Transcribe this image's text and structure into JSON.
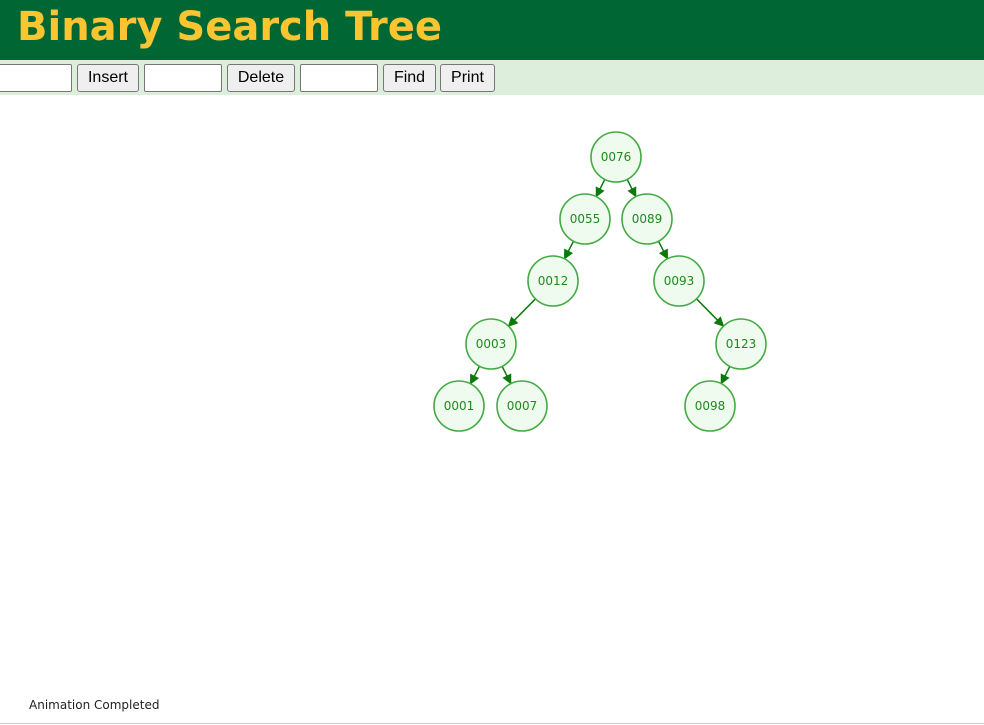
{
  "header": {
    "title": "Binary Search Tree"
  },
  "toolbar": {
    "insert_input_value": "",
    "insert_label": "Insert",
    "delete_input_value": "",
    "delete_label": "Delete",
    "find_input_value": "",
    "find_label": "Find",
    "print_label": "Print"
  },
  "tree": {
    "nodes": [
      {
        "id": "n76",
        "label": "0076"
      },
      {
        "id": "n55",
        "label": "0055"
      },
      {
        "id": "n89",
        "label": "0089"
      },
      {
        "id": "n12",
        "label": "0012"
      },
      {
        "id": "n93",
        "label": "0093"
      },
      {
        "id": "n3",
        "label": "0003"
      },
      {
        "id": "n123",
        "label": "0123"
      },
      {
        "id": "n1",
        "label": "0001"
      },
      {
        "id": "n7",
        "label": "0007"
      },
      {
        "id": "n98",
        "label": "0098"
      }
    ],
    "edges": [
      {
        "from": "n76",
        "to": "n55"
      },
      {
        "from": "n76",
        "to": "n89"
      },
      {
        "from": "n55",
        "to": "n12"
      },
      {
        "from": "n89",
        "to": "n93"
      },
      {
        "from": "n12",
        "to": "n3"
      },
      {
        "from": "n93",
        "to": "n123"
      },
      {
        "from": "n3",
        "to": "n1"
      },
      {
        "from": "n3",
        "to": "n7"
      },
      {
        "from": "n123",
        "to": "n98"
      }
    ]
  },
  "status": {
    "message": "Animation Completed"
  },
  "colors": {
    "header_bg": "#006633",
    "title_text": "#fbc531",
    "toolbar_bg": "#ddeedd",
    "node_fill": "#eefbee",
    "node_stroke": "#44aa44",
    "edge": "#0b7a0b"
  }
}
